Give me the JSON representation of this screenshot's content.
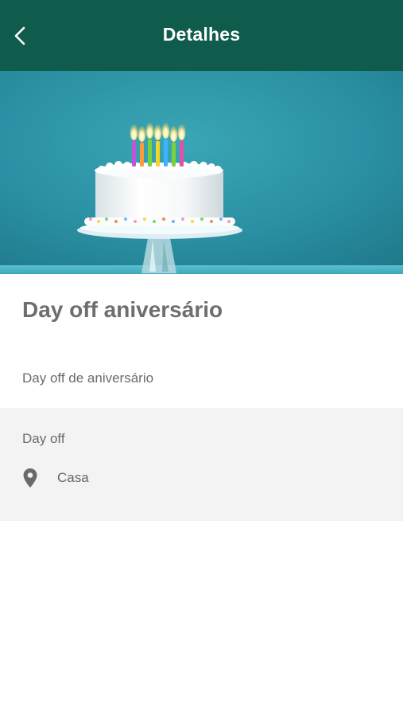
{
  "header": {
    "title": "Detalhes",
    "back_icon": "chevron-left-icon",
    "background": "#0f5c4c"
  },
  "hero": {
    "image": "birthday-cake-with-candles"
  },
  "event": {
    "title": "Day off aniversário",
    "description": "Day off de aniversário"
  },
  "info": {
    "category": "Day off",
    "location_icon": "location-pin-icon",
    "location": "Casa"
  }
}
